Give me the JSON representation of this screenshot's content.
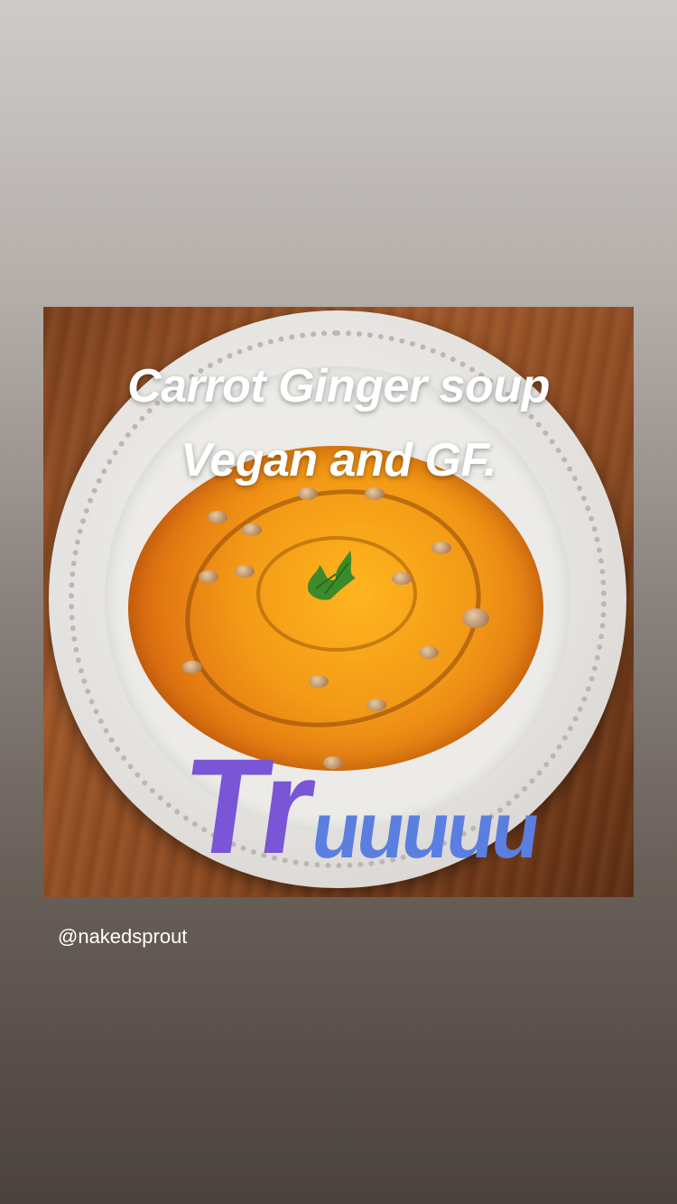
{
  "story": {
    "caption_line1": "Carrot Ginger soup",
    "caption_line2": "Vegan and GF.",
    "sticker_big": "Tr",
    "sticker_small": "uuuuu",
    "mention": "@nakedsprout"
  },
  "colors": {
    "caption_text": "#ffffff",
    "sticker_primary": "#7a55d6",
    "sticker_secondary": "#5b7fe0",
    "soup": "#f39a16"
  }
}
